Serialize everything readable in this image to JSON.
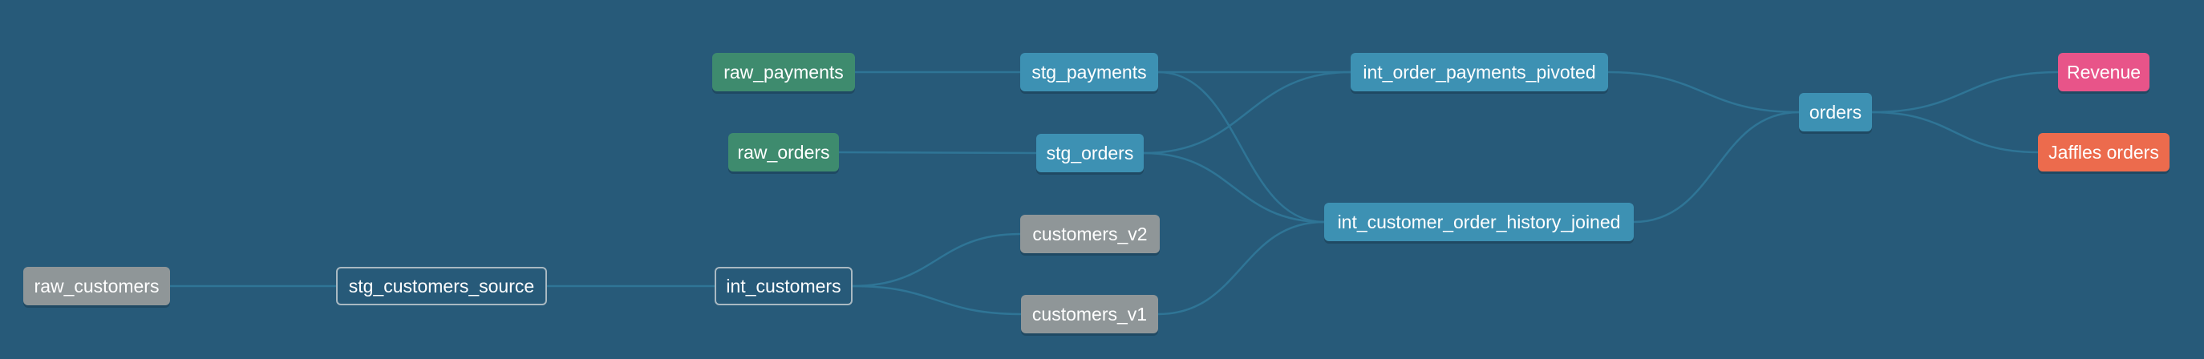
{
  "colors": {
    "background": "#275a79",
    "edge": "#2f7596",
    "source": "#3e8b6e",
    "model": "#3d91b3",
    "grey": "#8f9698",
    "revenue": "#e85489",
    "jaffles_orders": "#ec6b4d"
  },
  "nodes": {
    "raw_payments": "raw_payments",
    "raw_orders": "raw_orders",
    "raw_customers": "raw_customers",
    "stg_payments": "stg_payments",
    "stg_orders": "stg_orders",
    "stg_customers_source": "stg_customers_source",
    "int_customers": "int_customers",
    "customers_v2": "customers_v2",
    "customers_v1": "customers_v1",
    "int_order_payments_pivoted": "int_order_payments_pivoted",
    "int_customer_order_history_joined": "int_customer_order_history_joined",
    "orders": "orders",
    "revenue": "Revenue",
    "jaffles_orders": "Jaffles orders"
  },
  "edges": [
    [
      "raw_payments",
      "stg_payments"
    ],
    [
      "raw_orders",
      "stg_orders"
    ],
    [
      "raw_customers",
      "stg_customers_source"
    ],
    [
      "stg_customers_source",
      "int_customers"
    ],
    [
      "int_customers",
      "customers_v2"
    ],
    [
      "int_customers",
      "customers_v1"
    ],
    [
      "stg_payments",
      "int_order_payments_pivoted"
    ],
    [
      "stg_orders",
      "int_order_payments_pivoted"
    ],
    [
      "stg_payments",
      "int_customer_order_history_joined"
    ],
    [
      "stg_orders",
      "int_customer_order_history_joined"
    ],
    [
      "customers_v1",
      "int_customer_order_history_joined"
    ],
    [
      "int_order_payments_pivoted",
      "orders"
    ],
    [
      "int_customer_order_history_joined",
      "orders"
    ],
    [
      "orders",
      "revenue"
    ],
    [
      "orders",
      "jaffles_orders"
    ]
  ]
}
